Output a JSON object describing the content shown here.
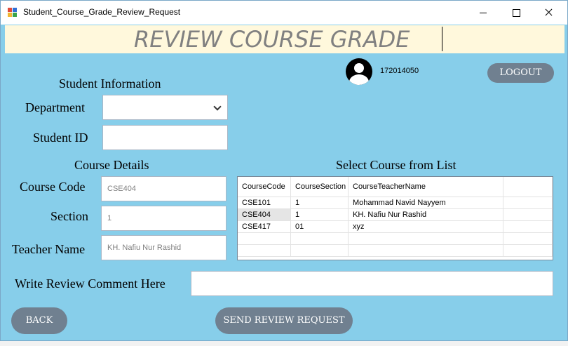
{
  "window": {
    "title": "Student_Course_Grade_Review_Request"
  },
  "banner": {
    "title": "REVIEW COURSE GRADE"
  },
  "user": {
    "id": "172014050",
    "logout_label": "LOGOUT"
  },
  "student_info": {
    "heading": "Student Information",
    "department_label": "Department",
    "department_value": "",
    "student_id_label": "Student ID",
    "student_id_value": ""
  },
  "course_details": {
    "heading": "Course Details",
    "course_code_label": "Course Code",
    "course_code_value": "CSE404",
    "section_label": "Section",
    "section_value": "1",
    "teacher_label": "Teacher Name",
    "teacher_value": "KH. Nafiu Nur Rashid"
  },
  "course_list": {
    "heading": "Select Course from List",
    "columns": [
      "CourseCode",
      "CourseSection",
      "CourseTeacherName"
    ],
    "rows": [
      [
        "CSE101",
        "1",
        "Mohammad Navid Nayyem"
      ],
      [
        "CSE404",
        "1",
        "KH. Nafiu Nur Rashid"
      ],
      [
        "CSE417",
        "01",
        "xyz"
      ]
    ]
  },
  "review": {
    "label": "Write Review Comment Here",
    "value": ""
  },
  "buttons": {
    "back": "BACK",
    "send": "SEND REVIEW REQUEST"
  },
  "colors": {
    "form_bg": "#87ceea",
    "banner_bg": "#fff8dc",
    "button_bg": "#708090"
  }
}
